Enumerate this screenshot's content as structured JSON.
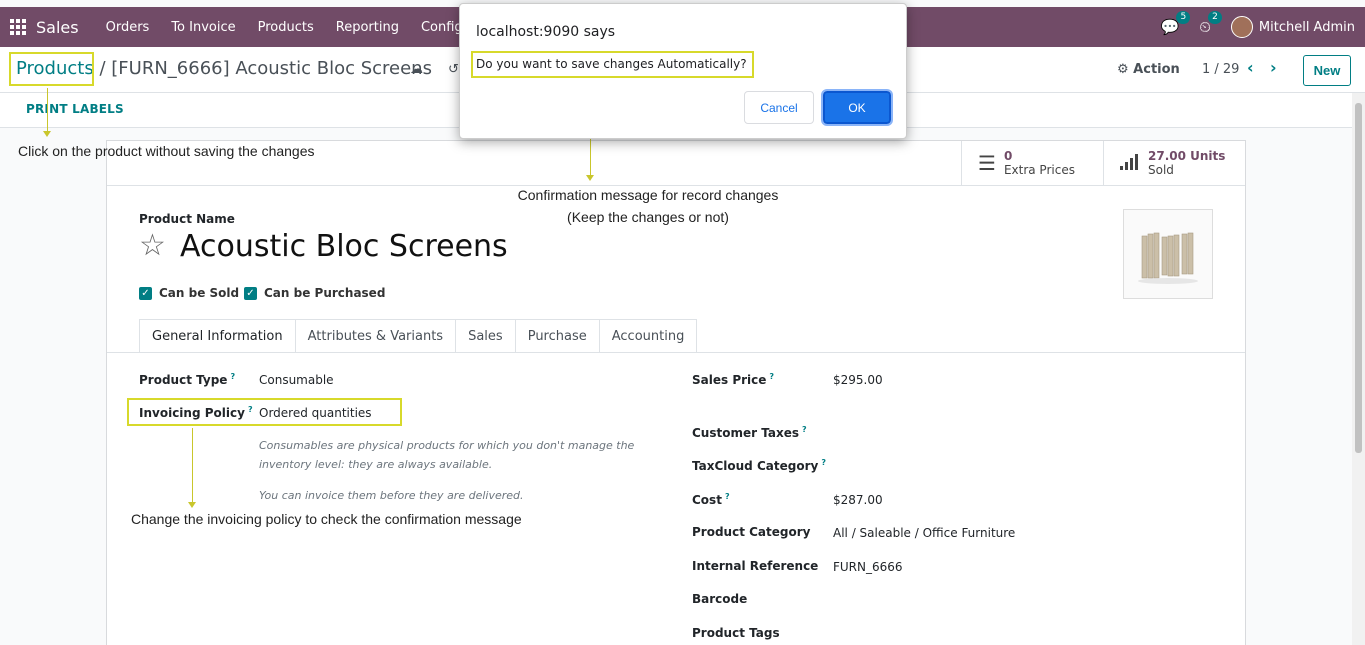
{
  "navbar": {
    "brand": "Sales",
    "menus": [
      "Orders",
      "To Invoice",
      "Products",
      "Reporting",
      "Configur"
    ],
    "messages_badge": "5",
    "activities_badge": "2",
    "user": "Mitchell Admin"
  },
  "control_panel": {
    "breadcrumb_parent": "Products",
    "breadcrumb_sep": "/",
    "breadcrumb_current": "[FURN_6666] Acoustic Bloc Screens",
    "action_label": "⚙ Action",
    "pager": "1 / 29",
    "new_label": "New"
  },
  "status_bar": {
    "print_labels": "PRINT LABELS"
  },
  "smart_buttons": {
    "extra_prices_value": "0",
    "extra_prices_label": "Extra Prices",
    "sold_value": "27.00 Units",
    "sold_label": "Sold"
  },
  "product": {
    "name_label": "Product Name",
    "name": "Acoustic Bloc Screens",
    "can_be_sold": "Can be Sold",
    "can_be_purchased": "Can be Purchased"
  },
  "tabs": [
    "General Information",
    "Attributes & Variants",
    "Sales",
    "Purchase",
    "Accounting"
  ],
  "fields_left": {
    "product_type_label": "Product Type",
    "product_type_value": "Consumable",
    "invoicing_policy_label": "Invoicing Policy",
    "invoicing_policy_value": "Ordered quantities",
    "help_1": "Consumables are physical products for which you don't manage the inventory level: they are always available.",
    "help_2": "You can invoice them before they are delivered."
  },
  "fields_right": {
    "sales_price_label": "Sales Price",
    "sales_price_value": "$295.00",
    "customer_taxes_label": "Customer Taxes",
    "taxcloud_label": "TaxCloud Category",
    "cost_label": "Cost",
    "cost_value": "$287.00",
    "category_label": "Product Category",
    "category_value": "All / Saleable / Office Furniture",
    "internal_ref_label": "Internal Reference",
    "internal_ref_value": "FURN_6666",
    "barcode_label": "Barcode",
    "tags_label": "Product Tags"
  },
  "dialog": {
    "origin": "localhost:9090 says",
    "message": "Do you want to save changes Automatically?",
    "cancel": "Cancel",
    "ok": "OK"
  },
  "annotations": {
    "note_products": "Click on the product without saving the changes",
    "note_confirm_1": "Confirmation message for record changes",
    "note_confirm_2": "(Keep the changes or not)",
    "note_invoicing": "Change the invoicing policy to check the confirmation message",
    "highlight_color": "#d7d92b"
  },
  "colors": {
    "navbar": "#714b67",
    "accent": "#017e84",
    "ok_button": "#1a73e8"
  }
}
